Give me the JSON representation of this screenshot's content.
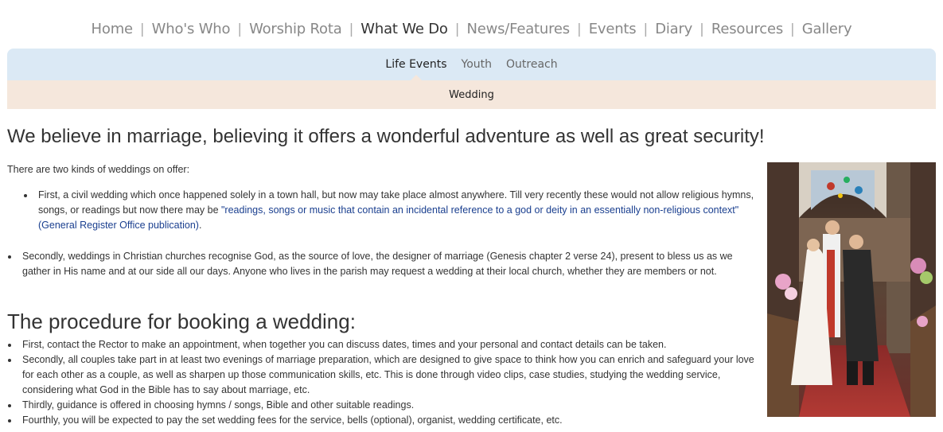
{
  "nav": {
    "items": [
      {
        "label": "Home",
        "active": false
      },
      {
        "label": "Who's Who",
        "active": false
      },
      {
        "label": "Worship Rota",
        "active": false
      },
      {
        "label": "What We Do",
        "active": true
      },
      {
        "label": "News/Features",
        "active": false
      },
      {
        "label": "Events",
        "active": false
      },
      {
        "label": "Diary",
        "active": false
      },
      {
        "label": "Resources",
        "active": false
      },
      {
        "label": "Gallery",
        "active": false
      }
    ],
    "separator": "|"
  },
  "subnav": {
    "items": [
      {
        "label": "Life Events",
        "active": true
      },
      {
        "label": "Youth",
        "active": false
      },
      {
        "label": "Outreach",
        "active": false
      }
    ]
  },
  "subsubnav": {
    "label": "Wedding"
  },
  "content": {
    "headline": "We believe in marriage, believing it offers a wonderful adventure as well as great security!",
    "intro": "There are two kinds of weddings on offer:",
    "civil": {
      "text_before": "First, a civil wedding which once happened solely in a town hall, but now may take place almost anywhere. Till very recently these would not allow religious hymns, songs, or readings but now there may be ",
      "link": "\"readings, songs or music that contain an incidental reference to a god or deity in an essentially non-religious context\" (General Register Office publication)",
      "text_after": "."
    },
    "christian": "Secondly, weddings in Christian churches recognise God, as the source of love, the designer of marriage (Genesis chapter 2 verse 24), present to bless us as we gather in His name and at our side all our days. Anyone who lives in the parish may request a wedding at their local church, whether they are members or not.",
    "procedure_title": "The procedure for booking a wedding:",
    "procedure_steps": [
      "First, contact the Rector to make an appointment, when together you can discuss dates, times and your personal and contact details can be taken.",
      "Secondly, all couples take part in at least two evenings of marriage preparation, which are designed to give space to think how you can enrich and safeguard your love for each other as a couple, as well as sharpen up those communication skills, etc. This is done through video clips, case studies, studying the wedding service, considering what God in the Bible has to say about marriage, etc.",
      "Thirdly, guidance is offered in choosing hymns / songs, Bible and other suitable readings.",
      "Fourthly, you will be expected to pay the set wedding fees for the service, bells (optional), organist, wedding certificate, etc."
    ]
  },
  "colors": {
    "subnav_bg": "#dbe9f5",
    "subsubnav_bg": "#f5e7dc",
    "link": "#1a3f8f"
  }
}
